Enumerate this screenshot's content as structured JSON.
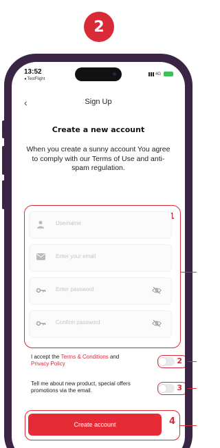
{
  "badge": {
    "step": "2"
  },
  "status": {
    "time": "13:52",
    "back_app": "◂ TestFlight",
    "network": "4G"
  },
  "nav": {
    "back_symbol": "‹",
    "title": "Sign Up"
  },
  "heading": "Create a new account",
  "terms_text": "When you create a sunny account You agree to comply with our Terms of Use and anti-spam regulation.",
  "fields": {
    "username_placeholder": "Username",
    "email_placeholder": "Enter your email",
    "password_placeholder": "Enter password",
    "confirm_placeholder": "Confirm password"
  },
  "callouts": {
    "fields": "1",
    "accept": "2",
    "newsletter": "3",
    "create": "4"
  },
  "accept": {
    "prefix": "I accept the ",
    "terms_link": "Terms & Conditions",
    "and": " and",
    "privacy_link": "Privacy Policy",
    "checked": false
  },
  "newsletter": {
    "text": "Tell me about new product, special offers promotions via the email.",
    "checked": false
  },
  "create_button": "Create account",
  "colors": {
    "accent": "#d92b37",
    "frame": "#3b2544"
  },
  "icons": [
    "user-icon",
    "mail-icon",
    "key-icon",
    "eye-off-icon"
  ]
}
